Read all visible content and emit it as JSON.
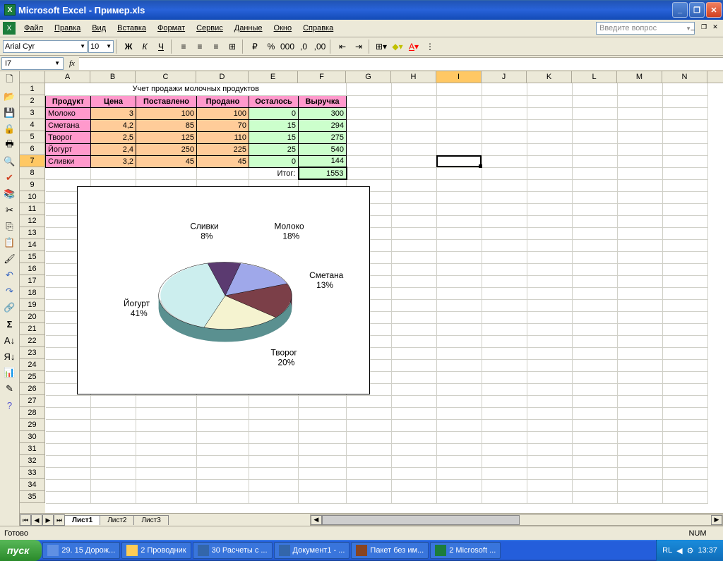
{
  "title": "Microsoft Excel - Пример.xls",
  "menus": [
    "Файл",
    "Правка",
    "Вид",
    "Вставка",
    "Формат",
    "Сервис",
    "Данные",
    "Окно",
    "Справка"
  ],
  "search_placeholder": "Введите вопрос",
  "font_name": "Arial Cyr",
  "font_size": "10",
  "namebox": "I7",
  "columns": [
    "A",
    "B",
    "C",
    "D",
    "E",
    "F",
    "G",
    "H",
    "I",
    "J",
    "K",
    "L",
    "M",
    "N"
  ],
  "active_col": "I",
  "active_row": 7,
  "table": {
    "title": "Учет продажи молочных продуктов",
    "headers": [
      "Продукт",
      "Цена",
      "Поставлено",
      "Продано",
      "Осталось",
      "Выручка"
    ],
    "rows": [
      {
        "prod": "Молоко",
        "price": "3",
        "supplied": "100",
        "sold": "100",
        "left": "0",
        "rev": "300"
      },
      {
        "prod": "Сметана",
        "price": "4,2",
        "supplied": "85",
        "sold": "70",
        "left": "15",
        "rev": "294"
      },
      {
        "prod": "Творог",
        "price": "2,5",
        "supplied": "125",
        "sold": "110",
        "left": "15",
        "rev": "275"
      },
      {
        "prod": "Йогурт",
        "price": "2,4",
        "supplied": "250",
        "sold": "225",
        "left": "25",
        "rev": "540"
      },
      {
        "prod": "Сливки",
        "price": "3,2",
        "supplied": "45",
        "sold": "45",
        "left": "0",
        "rev": "144"
      }
    ],
    "total_label": "Итог:",
    "total_value": "1553"
  },
  "chart_data": {
    "type": "pie",
    "categories": [
      "Молоко",
      "Сметана",
      "Творог",
      "Йогурт",
      "Сливки"
    ],
    "values": [
      18,
      13,
      20,
      41,
      8
    ],
    "labels": [
      "Молоко\n18%",
      "Сметана\n13%",
      "Творог\n20%",
      "Йогурт\n41%",
      "Сливки\n8%"
    ],
    "colors": [
      "#9fa8ea",
      "#7b3f48",
      "#f5f3d0",
      "#cceeee",
      "#5b3a70"
    ]
  },
  "chart_labels": {
    "slivki": "Сливки",
    "slivki_pct": "8%",
    "moloko": "Молоко",
    "moloko_pct": "18%",
    "smetana": "Сметана",
    "smetana_pct": "13%",
    "tvorog": "Творог",
    "tvorog_pct": "20%",
    "yogurt": "Йогурт",
    "yogurt_pct": "41%"
  },
  "sheets": [
    "Лист1",
    "Лист2",
    "Лист3"
  ],
  "active_sheet": 0,
  "status": "Готово",
  "num_indicator": "NUM",
  "start": "пуск",
  "taskbar": [
    "29. 15 Дорож...",
    "2 Проводник",
    "30 Расчеты с ...",
    "Документ1 - ...",
    "Пакет без им...",
    "2 Microsoft ..."
  ],
  "lang": "RL",
  "clock": "13:37"
}
